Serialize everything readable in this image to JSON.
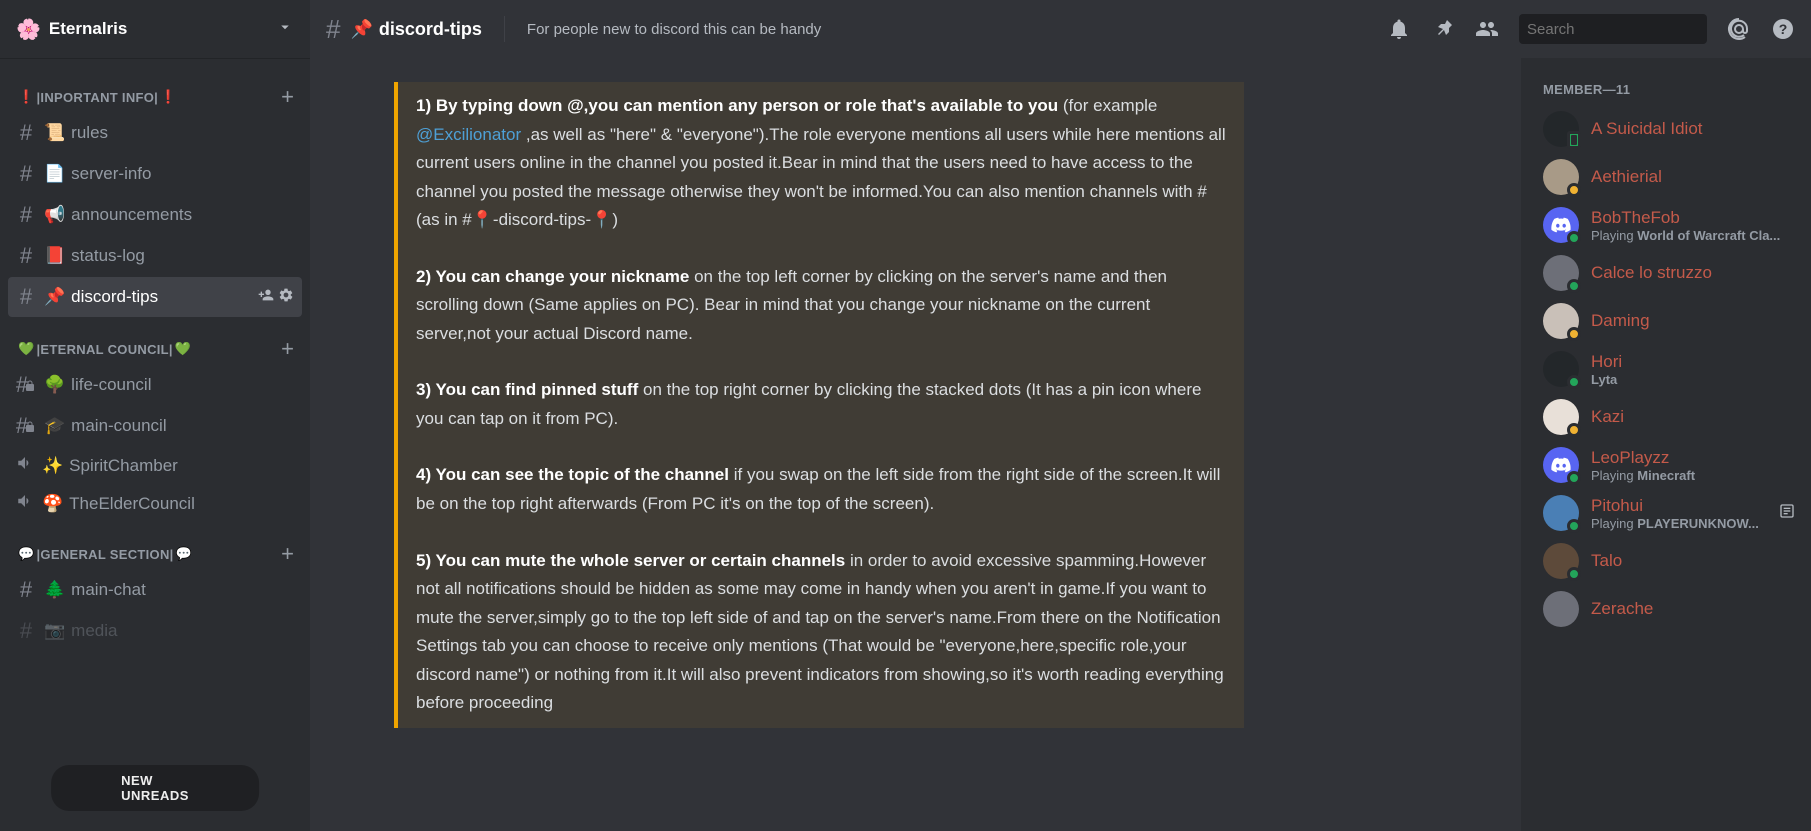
{
  "server": {
    "name": "Eternalris",
    "icon": "🌸"
  },
  "categories": [
    {
      "name_prefix": "❗",
      "name": "|INPORTANT INFO|",
      "name_suffix": "❗",
      "channels": [
        {
          "type": "text",
          "icon": "📜",
          "name": "rules"
        },
        {
          "type": "text",
          "icon": "📄",
          "name": "server-info"
        },
        {
          "type": "text",
          "icon": "📢",
          "name": "announcements"
        },
        {
          "type": "text",
          "icon": "📕",
          "name": "status-log"
        },
        {
          "type": "text",
          "icon": "📌",
          "name": "discord-tips",
          "active": true
        }
      ]
    },
    {
      "name_prefix": "💚",
      "name": "|ETERNAL COUNCIL|",
      "name_suffix": "💚",
      "channels": [
        {
          "type": "text",
          "icon": "🌳",
          "name": "life-council",
          "locked": true
        },
        {
          "type": "text",
          "icon": "🎓",
          "name": "main-council",
          "locked": true
        },
        {
          "type": "voice",
          "icon": "✨",
          "name": "SpiritChamber"
        },
        {
          "type": "voice",
          "icon": "🍄",
          "name": "TheElderCouncil"
        }
      ]
    },
    {
      "name_prefix": "💬",
      "name": "|GENERAL SECTION|",
      "name_suffix": "💬",
      "channels": [
        {
          "type": "text",
          "icon": "🌲",
          "name": "main-chat"
        },
        {
          "type": "text",
          "icon": "📷",
          "name": "media",
          "dim": true
        }
      ]
    }
  ],
  "new_unreads": "NEW UNREADS",
  "channel_header": {
    "icon": "📌",
    "name": "discord-tips",
    "topic": "For people new to discord this can be handy",
    "search_placeholder": "Search"
  },
  "message": {
    "p1_bold": "1) By typing down @,you can mention any person or role that's available to you",
    "p1_rest_a": " (for example ",
    "p1_mention": "@Excilionator",
    "p1_rest_b": "  ,as well as \"here\" & \"everyone\").The role everyone mentions all users while here mentions all current users online in the channel you posted it.Bear in mind that the users need to have access to the channel you posted the message otherwise they won't be informed.You can also mention channels  with # (as in #📍-discord-tips-📍)",
    "p2_bold": "2) You can change your nickname",
    "p2_rest": " on the top left corner by clicking on the server's name and then scrolling down (Same applies on PC). Bear in mind that you change your nickname on the current server,not your actual Discord name.",
    "p3_bold": "3) You can find pinned stuff",
    "p3_rest": " on the top right corner by clicking the stacked dots (It has a pin icon where you can tap on it from PC).",
    "p4_bold": "4) You can see the topic of the channel",
    "p4_rest": " if you swap on the left side from the right side of the screen.It will be on the top right afterwards (From PC it's on the top of the screen).",
    "p5_bold": "5) You can mute the whole server or certain channels",
    "p5_rest": " in order to avoid excessive spamming.However not all notifications should be hidden as some may come in handy when you aren't in game.If you want to mute the server,simply go to the top left side of and tap on the server's name.From there on the Notification Settings tab you can choose to receive only mentions (That would be \"everyone,here,specific role,your discord name\") or nothing from it.It will also prevent indicators from showing,so it's worth reading everything before proceeding"
  },
  "members_header": "MEMBER—11",
  "members": [
    {
      "name": "A Suicidal Idiot",
      "status": "mobile",
      "avatar": "dark"
    },
    {
      "name": "Aethierial",
      "status": "idle",
      "avatar": "tan"
    },
    {
      "name": "BobTheFob",
      "status": "online",
      "activity_prefix": "Playing ",
      "activity": "World of Warcraft Cla...",
      "avatar": "discord"
    },
    {
      "name": "Calce lo struzzo",
      "status": "online",
      "avatar": "gray"
    },
    {
      "name": "Daming",
      "status": "idle",
      "avatar": "light"
    },
    {
      "name": "Hori",
      "status": "online",
      "activity_prefix": "",
      "activity": "Lyta",
      "avatar": "dark"
    },
    {
      "name": "Kazi",
      "status": "idle",
      "avatar": "white"
    },
    {
      "name": "LeoPlayzz",
      "status": "online",
      "activity_prefix": "Playing ",
      "activity": "Minecraft",
      "avatar": "discord"
    },
    {
      "name": "Pitohui",
      "status": "online",
      "activity_prefix": "Playing ",
      "activity": "PLAYERUNKNOW...",
      "rich": true,
      "avatar": "blue"
    },
    {
      "name": "Talo",
      "status": "online",
      "avatar": "brown"
    },
    {
      "name": "Zerache",
      "status": "",
      "avatar": "gray"
    }
  ]
}
